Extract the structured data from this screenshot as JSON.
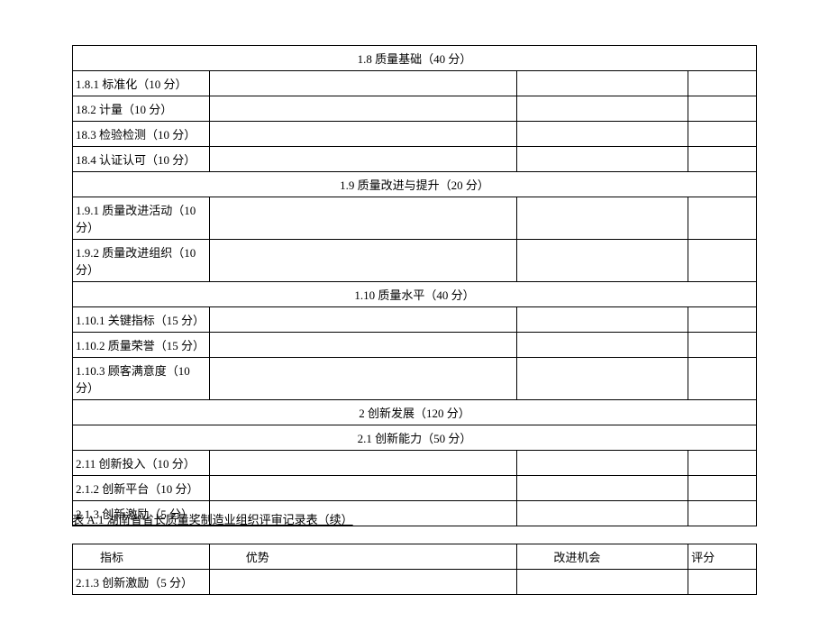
{
  "table1": {
    "sections": [
      {
        "header": "1.8 质量基础（40 分）",
        "rows": [
          "1.8.1 标准化（10 分）",
          "18.2 计量（10 分）",
          "18.3 检验检测（10 分）",
          "18.4 认证认可（10 分）"
        ]
      },
      {
        "header": "1.9 质量改进与提升（20 分）",
        "rows": [
          "1.9.1 质量改进活动（10 分）",
          "1.9.2 质量改进组织（10 分）"
        ]
      },
      {
        "header": "1.10 质量水平（40 分）",
        "rows": [
          "1.10.1 关键指标（15 分）",
          "1.10.2 质量荣誉（15 分）",
          "1.10.3 顾客满意度（10 分）"
        ]
      },
      {
        "header": "2 创新发展（120 分）",
        "rows": []
      },
      {
        "header": "2.1 创新能力（50 分）",
        "rows": [
          "2.11 创新投入（10 分）",
          "2.1.2 创新平台（10 分）",
          "2.1.3 创新激励（5 分）"
        ]
      }
    ]
  },
  "caption": "表 A.1 湖南省省长质量奖制造业组织评审记录表（续）",
  "table2": {
    "headers": {
      "indicator": "指标",
      "advantage": "优势",
      "improve": "改进机会",
      "score": "评分"
    },
    "rows": [
      {
        "indicator": "2.1.3 创新激励（5 分）",
        "advantage": "",
        "improve": "",
        "score": ""
      }
    ]
  }
}
